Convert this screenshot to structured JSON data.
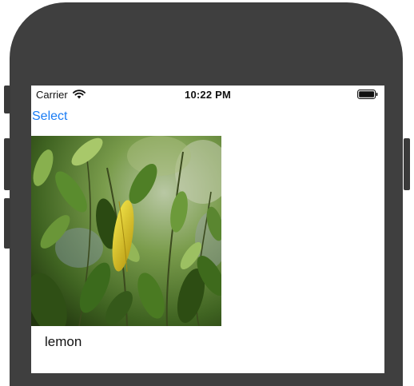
{
  "status_bar": {
    "carrier": "Carrier",
    "time": "10:22 PM",
    "wifi_icon": "wifi-icon",
    "battery_icon": "battery-icon"
  },
  "nav": {
    "select_label": "Select",
    "accent_color": "#1a7cf4"
  },
  "content": {
    "image_subject": "lemon tree leaves",
    "label": "lemon"
  }
}
